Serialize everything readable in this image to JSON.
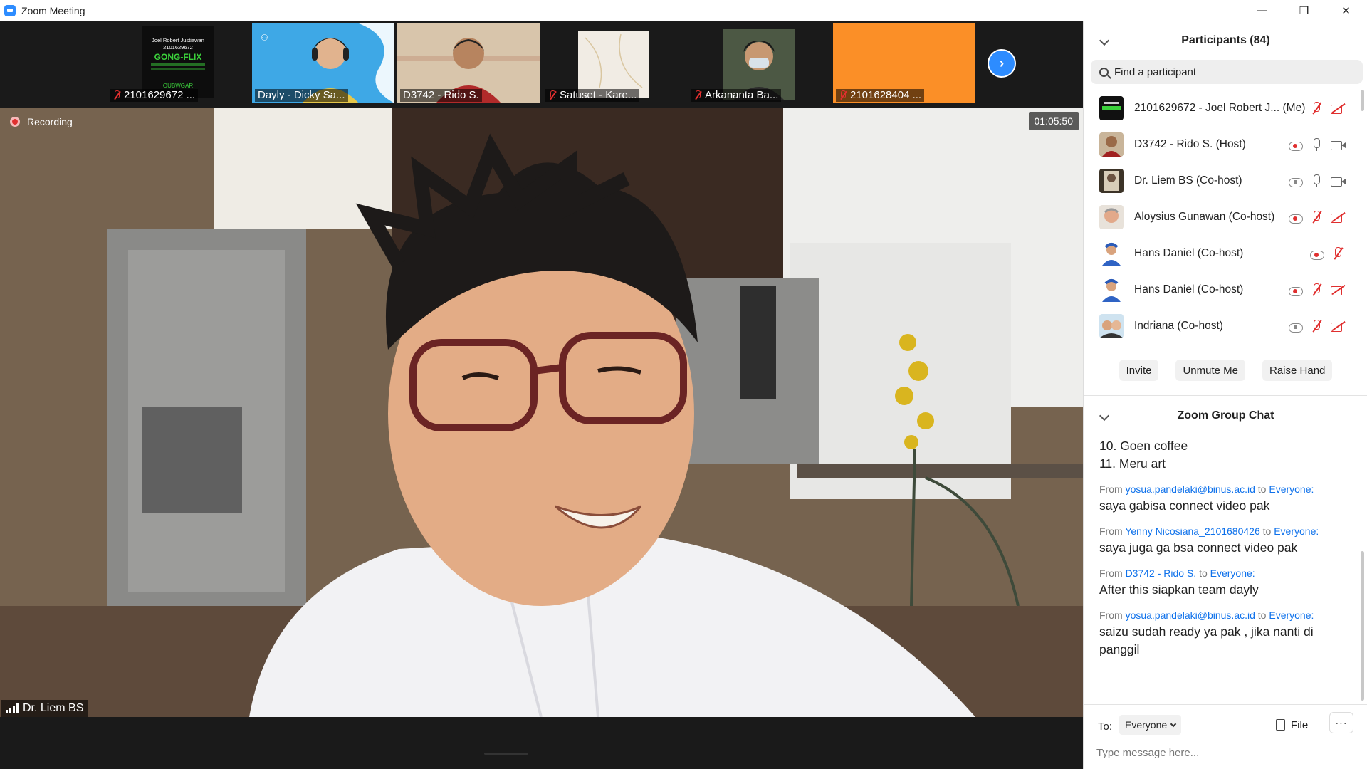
{
  "window": {
    "title": "Zoom Meeting"
  },
  "thumbnails": [
    {
      "label": "2101629672 ...",
      "muted": true,
      "poster": {
        "line1": "Joel Robert Justiawan",
        "line2": "2101629672",
        "line3": "GONG-FLIX",
        "line4": "OUBWGAR"
      }
    },
    {
      "label": "Dayly - Dicky Sa...",
      "muted": false
    },
    {
      "label": "D3742 - Rido S.",
      "muted": false
    },
    {
      "label": "Satuset - Kare...",
      "muted": true
    },
    {
      "label": "Arkananta Ba...",
      "muted": true
    },
    {
      "label": "2101628404 ...",
      "muted": true
    }
  ],
  "main_video": {
    "recording_label": "Recording",
    "timer": "01:05:50",
    "speaker_name": "Dr. Liem BS"
  },
  "participants": {
    "title": "Participants (84)",
    "search_placeholder": "Find a participant",
    "list": [
      {
        "name": "2101629672 - Joel Robert J...  (Me)",
        "icons": [
          "mic-off",
          "video-off"
        ]
      },
      {
        "name": "D3742 - Rido S. (Host)",
        "icons": [
          "record",
          "mic",
          "video"
        ]
      },
      {
        "name": "Dr. Liem BS (Co-host)",
        "icons": [
          "record-grey",
          "mic",
          "video"
        ]
      },
      {
        "name": "Aloysius Gunawan (Co-host)",
        "icons": [
          "record",
          "mic-off",
          "video-off"
        ]
      },
      {
        "name": "Hans Daniel (Co-host)",
        "icons": [
          "record",
          "mic-off"
        ]
      },
      {
        "name": "Hans Daniel (Co-host)",
        "icons": [
          "record",
          "mic-off",
          "video-off"
        ]
      },
      {
        "name": "Indriana (Co-host)",
        "icons": [
          "record-grey",
          "mic-off",
          "video-off"
        ]
      }
    ],
    "buttons": {
      "invite": "Invite",
      "unmute": "Unmute Me",
      "raise_hand": "Raise Hand"
    }
  },
  "chat": {
    "title": "Zoom Group Chat",
    "list_lines": [
      "10. Goen coffee",
      "11. Meru art"
    ],
    "messages": [
      {
        "from_prefix": "From",
        "sender": "yosua.pandelaki@binus.ac.id",
        "to_word": "to",
        "recipient": "Everyone:",
        "text": "saya gabisa connect video pak"
      },
      {
        "from_prefix": "From",
        "sender": "Yenny Nicosiana_2101680426",
        "to_word": "to",
        "recipient": "Everyone:",
        "text": "saya juga ga bsa connect video pak"
      },
      {
        "from_prefix": "From",
        "sender": "D3742 - Rido S.",
        "to_word": "to",
        "recipient": "Everyone:",
        "text": "After this siapkan team dayly"
      },
      {
        "from_prefix": "From",
        "sender": "yosua.pandelaki@binus.ac.id",
        "to_word": "to",
        "recipient": "Everyone:",
        "text": "saizu sudah ready ya pak , jika nanti di panggil"
      }
    ],
    "compose": {
      "to_label": "To:",
      "recipient": "Everyone",
      "file_label": "File",
      "more_label": "···",
      "placeholder": "Type message here..."
    }
  },
  "colors": {
    "accent": "#2d8cff",
    "link": "#0e71eb",
    "danger": "#e02f2f"
  }
}
